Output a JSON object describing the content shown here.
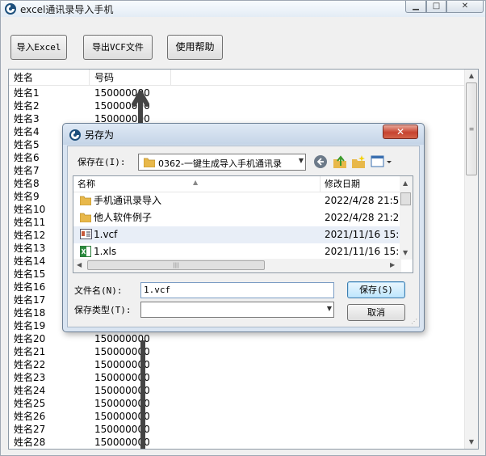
{
  "window": {
    "title": "excel通讯录导入手机"
  },
  "toolbar": {
    "import_label": "导入Excel",
    "export_label": "导出VCF文件",
    "help_label": "使用帮助"
  },
  "list": {
    "columns": [
      "姓名",
      "号码"
    ],
    "rows": [
      {
        "name": "姓名1",
        "phone": "150000000"
      },
      {
        "name": "姓名2",
        "phone": "150000000"
      },
      {
        "name": "姓名3",
        "phone": "150000000"
      },
      {
        "name": "姓名4",
        "phone": ""
      },
      {
        "name": "姓名5",
        "phone": ""
      },
      {
        "name": "姓名6",
        "phone": ""
      },
      {
        "name": "姓名7",
        "phone": ""
      },
      {
        "name": "姓名8",
        "phone": ""
      },
      {
        "name": "姓名9",
        "phone": ""
      },
      {
        "name": "姓名10",
        "phone": ""
      },
      {
        "name": "姓名11",
        "phone": ""
      },
      {
        "name": "姓名12",
        "phone": ""
      },
      {
        "name": "姓名13",
        "phone": ""
      },
      {
        "name": "姓名14",
        "phone": ""
      },
      {
        "name": "姓名15",
        "phone": ""
      },
      {
        "name": "姓名16",
        "phone": ""
      },
      {
        "name": "姓名17",
        "phone": ""
      },
      {
        "name": "姓名18",
        "phone": ""
      },
      {
        "name": "姓名19",
        "phone": ""
      },
      {
        "name": "姓名20",
        "phone": "150000000"
      },
      {
        "name": "姓名21",
        "phone": "150000000"
      },
      {
        "name": "姓名22",
        "phone": "150000000"
      },
      {
        "name": "姓名23",
        "phone": "150000000"
      },
      {
        "name": "姓名24",
        "phone": "150000000"
      },
      {
        "name": "姓名25",
        "phone": "150000000"
      },
      {
        "name": "姓名26",
        "phone": "150000000"
      },
      {
        "name": "姓名27",
        "phone": "150000000"
      },
      {
        "name": "姓名28",
        "phone": "150000000"
      }
    ]
  },
  "dialog": {
    "title": "另存为",
    "close_label": "✕",
    "save_in_label": "保存在(I):",
    "current_folder": "0362-一键生成导入手机通讯录",
    "columns": [
      "名称",
      "修改日期"
    ],
    "files": [
      {
        "name": "手机通讯录导入",
        "date": "2022/4/28 21:5",
        "icon": "folder-icon"
      },
      {
        "name": "他人软件例子",
        "date": "2022/4/28 21:2",
        "icon": "folder-icon"
      },
      {
        "name": "1.vcf",
        "date": "2021/11/16 15:",
        "icon": "vcf-file-icon"
      },
      {
        "name": "1.xls",
        "date": "2021/11/16 15:",
        "icon": "excel-file-icon"
      }
    ],
    "file_name_label": "文件名(N):",
    "file_name_value": "1.vcf",
    "file_type_label": "保存类型(T):",
    "file_type_value": "",
    "save_label": "保存(S)",
    "cancel_label": "取消"
  },
  "colors": {
    "dialog_frame": "#d9e4f1",
    "close_button": "#c7432f",
    "selection": "#e8eef7"
  }
}
